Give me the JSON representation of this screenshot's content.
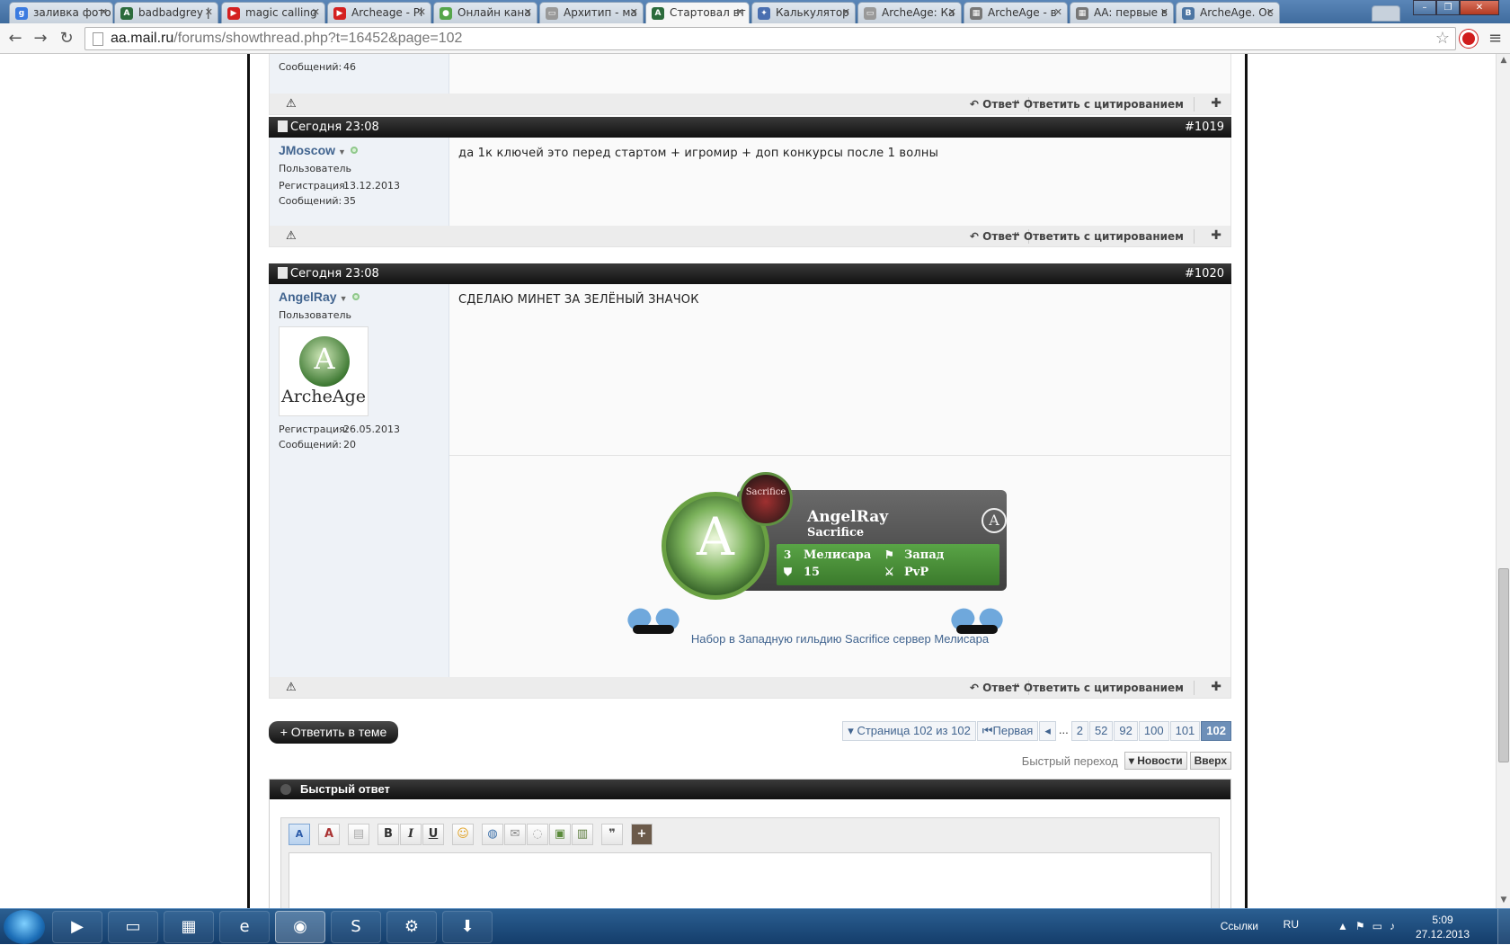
{
  "browser": {
    "tabs": [
      {
        "title": "заливка фото",
        "fav_color": "#3b7be0",
        "fav_letter": "g"
      },
      {
        "title": "badbadgrey |",
        "fav_color": "#2c6b3c",
        "fav_letter": "A"
      },
      {
        "title": "magic calling",
        "fav_color": "#d42020",
        "fav_letter": "▶"
      },
      {
        "title": "Archeage - Pl",
        "fav_color": "#d42020",
        "fav_letter": "▶"
      },
      {
        "title": "Онлайн кана",
        "fav_color": "#56a54a",
        "fav_letter": "●"
      },
      {
        "title": "Архитип - ма",
        "fav_color": "#999999",
        "fav_letter": "▭"
      },
      {
        "title": "Стартовал вт",
        "fav_color": "#2c6b3c",
        "fav_letter": "A"
      },
      {
        "title": "Калькулятор",
        "fav_color": "#4a6fb0",
        "fav_letter": "✦"
      },
      {
        "title": "ArcheAge: Ка",
        "fav_color": "#999999",
        "fav_letter": "▭"
      },
      {
        "title": "ArcheAge - в",
        "fav_color": "#777777",
        "fav_letter": "▦"
      },
      {
        "title": "АА: первые в",
        "fav_color": "#777777",
        "fav_letter": "▦"
      },
      {
        "title": "ArcheAge. Ос",
        "fav_color": "#4c75a3",
        "fav_letter": "B"
      }
    ],
    "url_host": "aa.mail.ru",
    "url_path": "/forums/showthread.php?t=16452&page=102"
  },
  "posts": [
    {
      "messages_label": "Сообщений:",
      "messages_count": "46",
      "reply_label": "Ответ",
      "quote_label": "Ответить с цитированием"
    },
    {
      "date": "Сегодня 23:08",
      "number": "#1019",
      "username": "JMoscow",
      "user_title": "Пользователь",
      "reg_label": "Регистрация:",
      "reg_date": "13.12.2013",
      "messages_label": "Сообщений:",
      "messages_count": "35",
      "message": "да 1к ключей это перед стартом + игромир + доп конкурсы после 1 волны",
      "reply_label": "Ответ",
      "quote_label": "Ответить с цитированием"
    },
    {
      "date": "Сегодня 23:08",
      "number": "#1020",
      "username": "AngelRay",
      "user_title": "Пользователь",
      "avatar_brand": "ArcheAge",
      "reg_label": "Регистрация:",
      "reg_date": "26.05.2013",
      "messages_label": "Сообщений:",
      "messages_count": "20",
      "message": "СДЕЛАЮ МИНЕТ ЗА ЗЕЛЁНЫЙ ЗНАЧОК",
      "signature": {
        "char_name": "AngelRay",
        "guild": "Sacrifice",
        "guild_icon_text": "Sacrifice",
        "server": "Мелисара",
        "faction": "Запад",
        "level": "15",
        "mode": "PvP",
        "server_badge": "3",
        "recruit_text": "Набор в Западную гильдию Sacrifice сервер Мелисара"
      },
      "reply_label": "Ответ",
      "quote_label": "Ответить с цитированием"
    }
  ],
  "thread_controls": {
    "reply_thread": "+ Ответить в теме",
    "page_info": "Страница 102 из 102",
    "first": "Первая",
    "pages": [
      "2",
      "52",
      "92",
      "100",
      "101"
    ],
    "current_page": "102",
    "dots": "...",
    "quick_nav_label": "Быстрый переход",
    "quick_nav_value": "Новости",
    "top_button": "Вверх"
  },
  "quick_reply": {
    "title": "Быстрый ответ"
  },
  "taskbar": {
    "links_label": "Ссылки",
    "lang": "RU",
    "time": "5:09",
    "date": "27.12.2013"
  }
}
